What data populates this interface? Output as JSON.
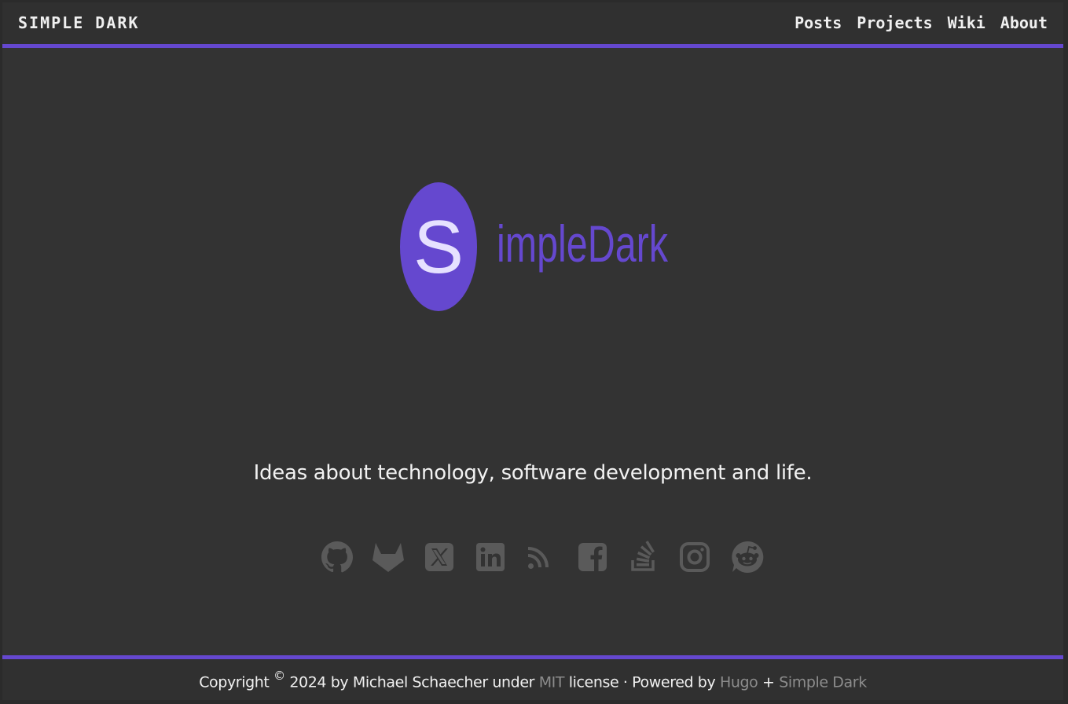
{
  "header": {
    "site_title": "SIMPLE DARK",
    "nav": [
      "Posts",
      "Projects",
      "Wiki",
      "About"
    ]
  },
  "logo": {
    "letter": "S",
    "wordmark": "impleDark"
  },
  "tagline": "Ideas about technology, software development and life.",
  "social_icons": [
    "github-icon",
    "gitlab-icon",
    "x-icon",
    "linkedin-icon",
    "rss-icon",
    "facebook-icon",
    "stackoverflow-icon",
    "instagram-icon",
    "reddit-icon"
  ],
  "footer": {
    "copyright": "Copyright",
    "copyright_symbol": "©",
    "year_author": "2024 by Michael Schaecher under",
    "license_link": "MIT",
    "license_suffix": "license · Powered by",
    "hugo_link": "Hugo",
    "plus": "+",
    "theme_link": "Simple Dark"
  },
  "colors": {
    "accent": "#6548cf",
    "background": "#333333",
    "icon": "#5a5a5a",
    "link": "#8c8c8c"
  }
}
